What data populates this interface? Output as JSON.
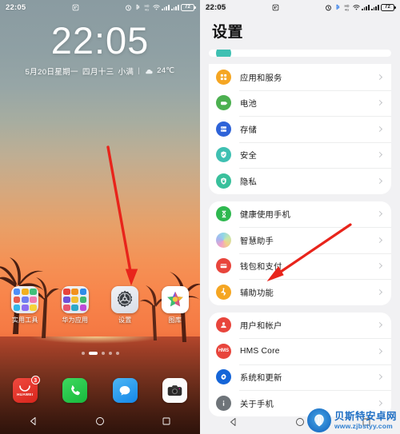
{
  "left_phone": {
    "status_bar": {
      "time": "22:05",
      "battery_level": "72",
      "icons": [
        "alarm-icon",
        "bluetooth-icon",
        "hd-call-icon",
        "wifi-icon",
        "signal-bars-icon",
        "signal-bars-icon",
        "battery-icon"
      ]
    },
    "lock_clock": "22:05",
    "date_line": {
      "gregorian": "5月20日星期一",
      "lunar": "四月十三",
      "solar_term": "小满",
      "separator": "|",
      "temperature": "24℃"
    },
    "apps": [
      {
        "label": "实用工具",
        "icon": "folder-icon"
      },
      {
        "label": "华为应用",
        "icon": "folder-icon"
      },
      {
        "label": "设置",
        "icon": "settings-gear-icon"
      },
      {
        "label": "图库",
        "icon": "gallery-icon"
      }
    ],
    "page_dots": {
      "count": 5,
      "active_index": 1
    },
    "dock": [
      {
        "label": "应用市场",
        "icon": "huawei-appgallery-icon",
        "badge": "3",
        "brand_text": "HUAWEI"
      },
      {
        "label": "电话",
        "icon": "phone-icon"
      },
      {
        "label": "信息",
        "icon": "messages-icon"
      },
      {
        "label": "相机",
        "icon": "camera-icon"
      }
    ],
    "nav_bar": [
      "back-icon",
      "home-icon",
      "recents-icon"
    ]
  },
  "right_phone": {
    "status_bar": {
      "time": "22:05",
      "battery_level": "72"
    },
    "title": "设置",
    "groups": [
      {
        "items": [
          {
            "label": "应用和服务",
            "icon": "apps-services-icon",
            "color": "#F5A623"
          },
          {
            "label": "电池",
            "icon": "battery-icon",
            "color": "#4CB050"
          },
          {
            "label": "存储",
            "icon": "storage-icon",
            "color": "#2E63D8"
          },
          {
            "label": "安全",
            "icon": "security-shield-icon",
            "color": "#3FC0B2"
          },
          {
            "label": "隐私",
            "icon": "privacy-lock-icon",
            "color": "#39C09C"
          }
        ]
      },
      {
        "items": [
          {
            "label": "健康使用手机",
            "icon": "digital-balance-icon",
            "color": "#2EB84F"
          },
          {
            "label": "智慧助手",
            "icon": "ai-assistant-icon",
            "color": "#9BB5E8"
          },
          {
            "label": "钱包和支付",
            "icon": "wallet-payment-icon",
            "color": "#E8453C"
          },
          {
            "label": "辅助功能",
            "icon": "accessibility-icon",
            "color": "#F5A623"
          }
        ]
      },
      {
        "items": [
          {
            "label": "用户和帐户",
            "icon": "user-account-icon",
            "color": "#E8453C"
          },
          {
            "label": "HMS Core",
            "icon": "hms-core-icon",
            "color": "#E8453C",
            "badge_text": "HMS"
          },
          {
            "label": "系统和更新",
            "icon": "system-update-icon",
            "color": "#1565D8"
          },
          {
            "label": "关于手机",
            "icon": "about-phone-icon",
            "color": "#6E7479"
          }
        ]
      }
    ],
    "nav_bar": [
      "back-icon",
      "home-icon",
      "recents-icon"
    ]
  },
  "annotations": {
    "arrow_color": "#E8241B",
    "left_arrow_target": "设置",
    "right_arrow_target": "辅助功能"
  },
  "watermark": {
    "site_name": "贝斯特安卓网",
    "url": "www.zjbstyy.com",
    "logo": "shell-logo-icon"
  }
}
